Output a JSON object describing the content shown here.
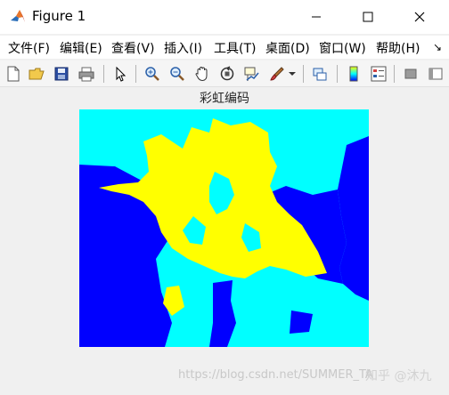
{
  "window": {
    "title": "Figure 1",
    "controls": {
      "minimize": "minimize",
      "maximize": "maximize",
      "close": "close"
    }
  },
  "menubar": {
    "items": [
      "文件(F)",
      "编辑(E)",
      "查看(V)",
      "插入(I)",
      "工具(T)",
      "桌面(D)",
      "窗口(W)",
      "帮助(H)"
    ],
    "overflow": "↘"
  },
  "toolbar": {
    "icons": [
      "new-figure-icon",
      "open-file-icon",
      "save-icon",
      "print-icon",
      "select-arrow-icon",
      "zoom-in-icon",
      "zoom-out-icon",
      "pan-hand-icon",
      "rotate-3d-icon",
      "data-cursor-icon",
      "brush-icon",
      "dropdown-icon",
      "link-plot-icon",
      "colorbar-icon",
      "legend-icon",
      "hide-plot-tools-icon",
      "show-plot-tools-icon"
    ]
  },
  "axes": {
    "title": "彩虹编码",
    "colors": {
      "background": "#00ffff",
      "water": "#0000ff",
      "petals": "#ffff00"
    }
  },
  "overlay": {
    "source_watermark": "https://blog.csdn.net/SUMMER_TA",
    "site_watermark": "知乎 @沐九"
  }
}
